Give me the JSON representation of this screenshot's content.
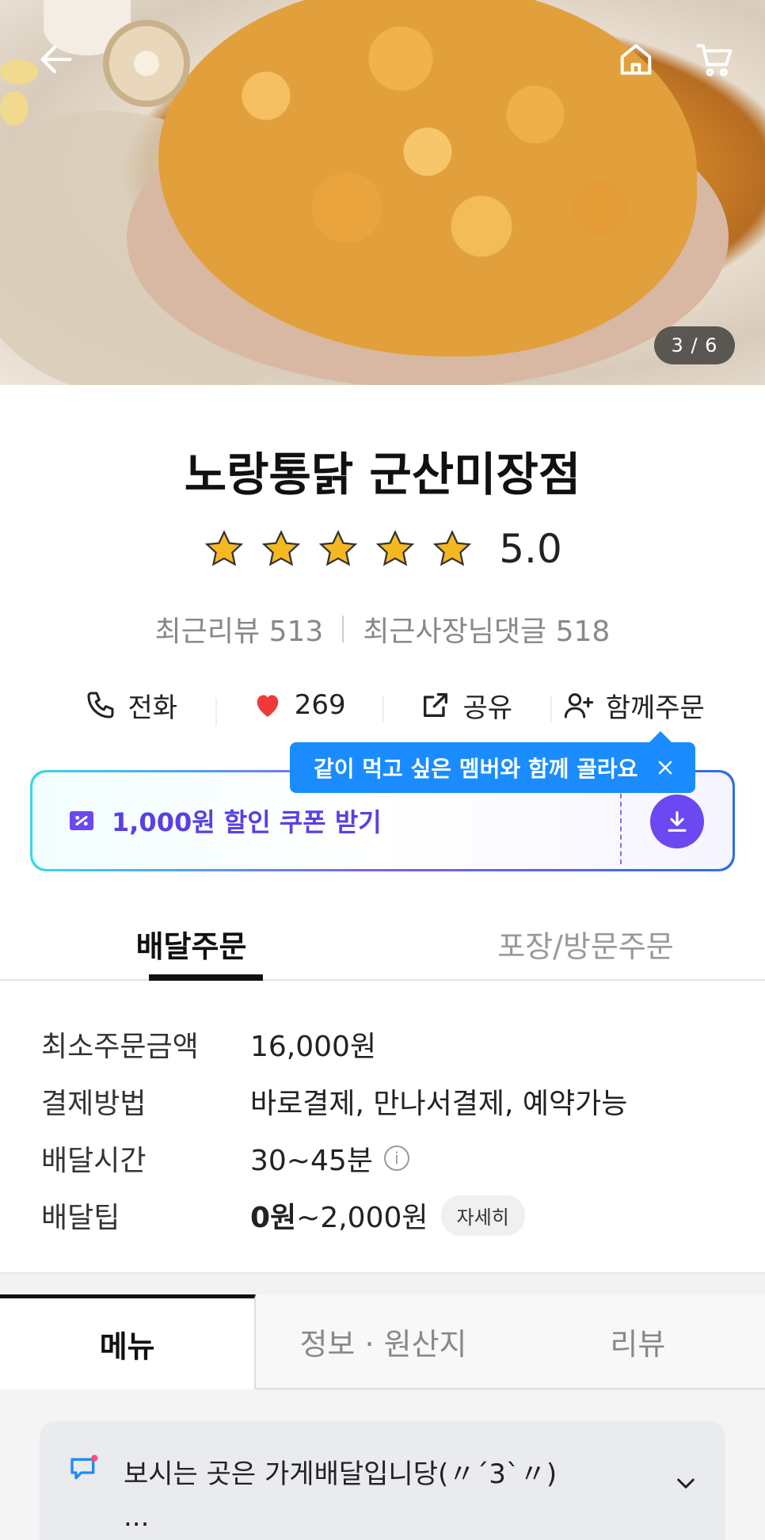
{
  "hero": {
    "image_counter": "3 / 6",
    "icons": {
      "back": "back-arrow-icon",
      "home": "home-icon",
      "cart": "cart-icon"
    }
  },
  "store": {
    "name": "노랑통닭 군산미장점",
    "rating_value": "5.0",
    "stars": 5,
    "recent_reviews": "최근리뷰 513",
    "recent_owner_replies": "최근사장님댓글 518"
  },
  "actions": {
    "call": "전화",
    "likes": "269",
    "share": "공유",
    "group_order": "함께주문"
  },
  "tooltip": {
    "text": "같이 먹고 싶은 멤버와 함께 골라요"
  },
  "coupon": {
    "text": "1,000원 할인 쿠폰 받기"
  },
  "order_tabs": [
    {
      "label": "배달주문",
      "active": true
    },
    {
      "label": "포장/방문주문",
      "active": false
    }
  ],
  "info": {
    "min_order_label": "최소주문금액",
    "min_order_value": "16,000원",
    "payment_label": "결제방법",
    "payment_value": "바로결제, 만나서결제, 예약가능",
    "delivery_time_label": "배달시간",
    "delivery_time_value": "30~45분",
    "delivery_tip_label": "배달팁",
    "delivery_tip_min": "0원",
    "delivery_tip_max": "~2,000원",
    "detail_button": "자세히"
  },
  "main_tabs": [
    {
      "label": "메뉴",
      "active": true
    },
    {
      "label": "정보 · 원산지",
      "active": false
    },
    {
      "label": "리뷰",
      "active": false
    }
  ],
  "notice": {
    "line1": "보시는 곳은 가게배달입니당(〃´3`〃)",
    "line2": "..."
  },
  "colors": {
    "accent_blue": "#1a8cff",
    "coupon_purple": "#5b3fe3",
    "heart_red": "#f03a3a",
    "star_yellow": "#f5b820"
  }
}
